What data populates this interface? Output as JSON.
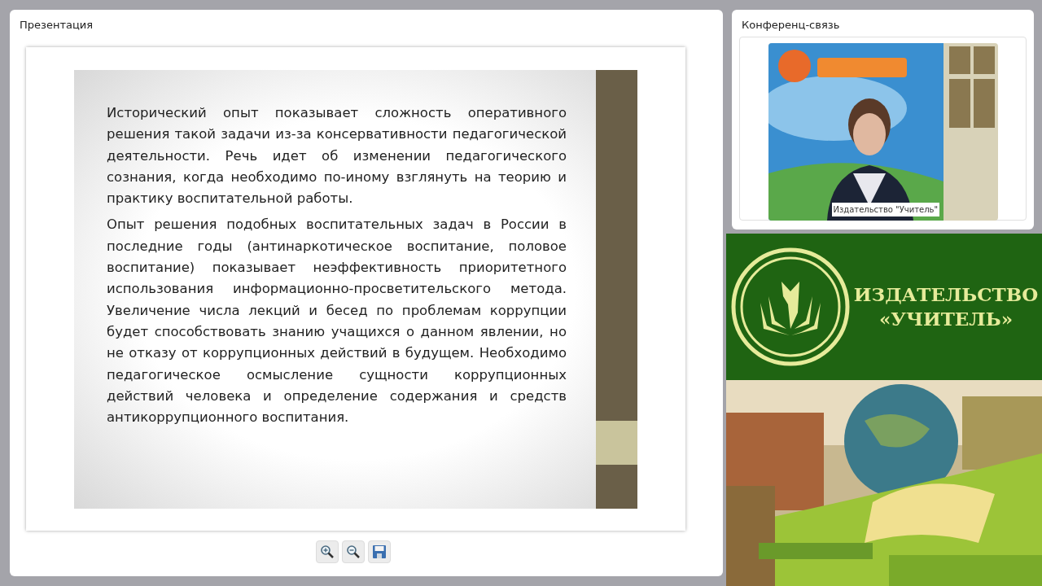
{
  "presentation": {
    "title": "Презентация",
    "slide": {
      "paragraphs": [
        "Исторический опыт показывает сложность оперативного решения такой задачи из-за консервативности педагогической деятельности. Речь идет об изменении педагогического сознания, когда необходимо по-иному взглянуть на теорию и практику воспитательной работы.",
        "Опыт решения подобных воспитательных задач в России в последние годы (антинаркотическое воспитание, половое воспитание) показывает неэффективность приоритетного использования информационно-просветительского метода. Увеличение числа лекций и бесед по проблемам коррупции будет способствовать знанию учащихся о данном явлении, но не отказу от коррупционных действий в будущем. Необходимо педагогическое осмысление сущности коррупционных действий человека и определение содержания и средств антикоррупционного воспитания."
      ]
    },
    "toolbar": [
      {
        "kind": "zoom-in"
      },
      {
        "kind": "zoom-out"
      },
      {
        "kind": "save"
      }
    ]
  },
  "conference": {
    "title": "Конференц-связь",
    "video": {
      "caption": "Издательство \"Учитель\""
    }
  },
  "banner": {
    "lines": [
      "ИЗДАТЕЛЬСТВО",
      "«УЧИТЕЛЬ»"
    ]
  }
}
